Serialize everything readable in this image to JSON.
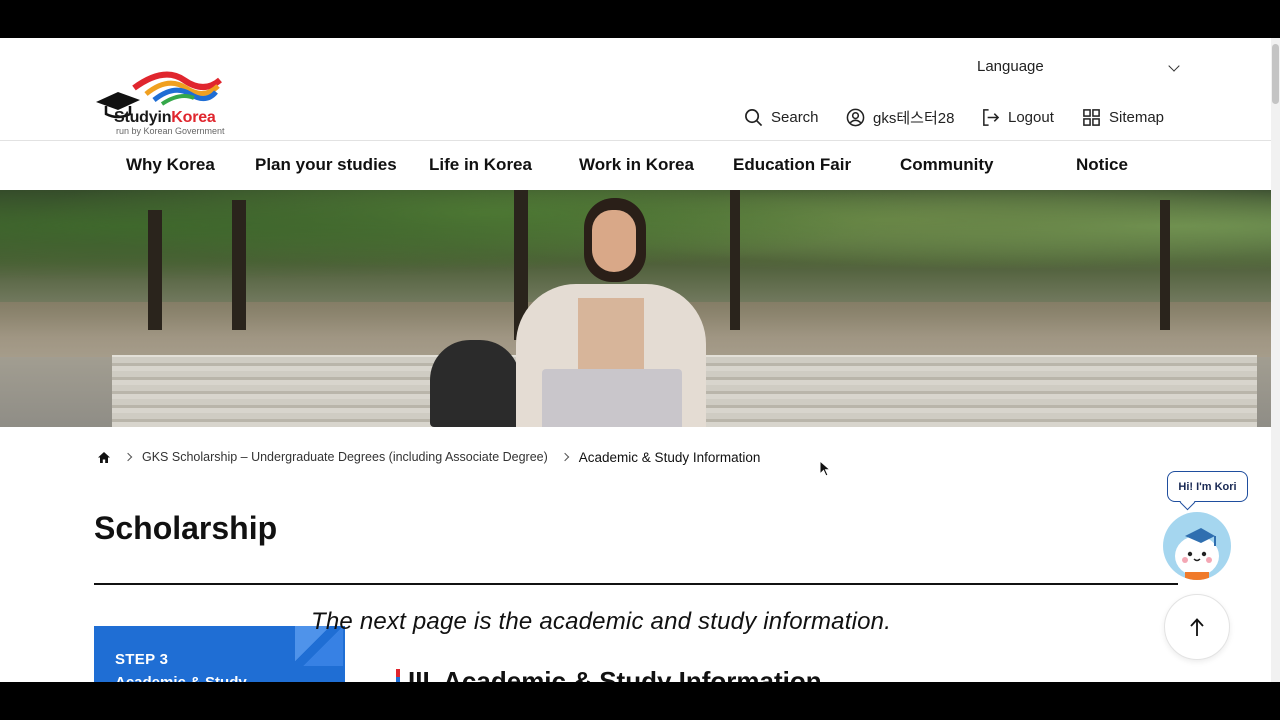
{
  "header": {
    "logo": {
      "brand_part1": "Studyin",
      "brand_part2": "Korea",
      "tagline": "run by Korean Government"
    },
    "language_label": "Language",
    "utility": [
      {
        "icon": "search-icon",
        "label": "Search"
      },
      {
        "icon": "user-circle-icon",
        "label": "gks테스터28"
      },
      {
        "icon": "logout-icon",
        "label": "Logout"
      },
      {
        "icon": "grid-icon",
        "label": "Sitemap"
      }
    ]
  },
  "nav": {
    "items": [
      "Why Korea",
      "Plan your studies",
      "Life in Korea",
      "Work in Korea",
      "Education Fair",
      "Community",
      "Notice"
    ]
  },
  "breadcrumb": {
    "home_icon": "home-icon",
    "items": [
      "GKS Scholarship – Undergraduate Degrees (including Associate Degree)",
      "Academic & Study Information"
    ]
  },
  "main": {
    "title": "Scholarship",
    "step_label": "STEP 3",
    "step_subtitle": "Academic & Study",
    "next_message": "The next page is the academic and study information.",
    "section_heading": "III. Academic & Study Information"
  },
  "chatbot": {
    "greeting": "Hi! I'm Kori"
  },
  "colors": {
    "brand_blue": "#1f6ed4",
    "brand_red": "#e0262e",
    "text": "#111111"
  }
}
